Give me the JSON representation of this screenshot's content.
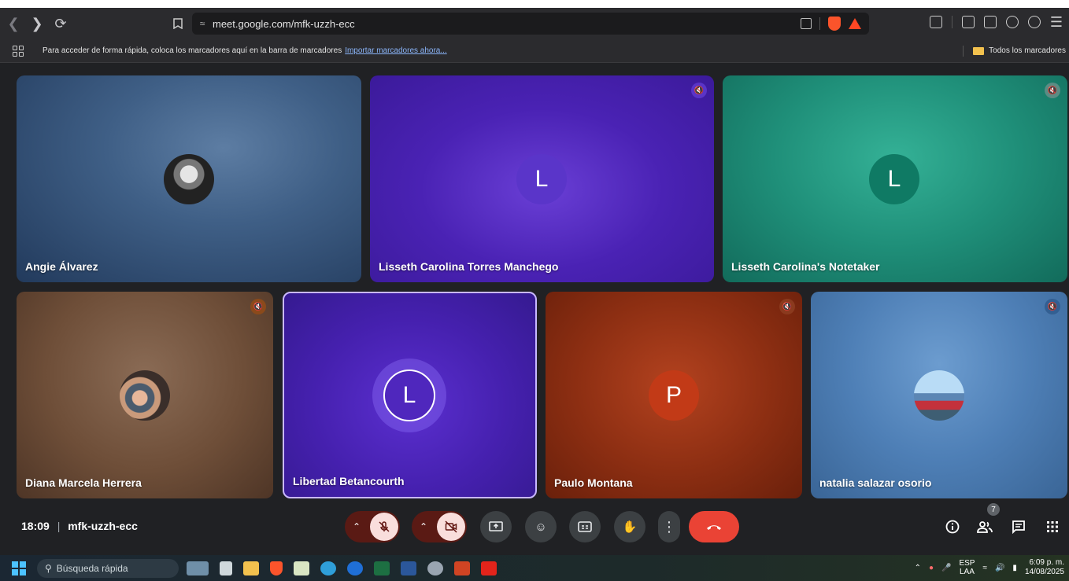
{
  "browser": {
    "url": "meet.google.com/mfk-uzzh-ecc",
    "bookmark_hint": "Para acceder de forma rápida, coloca los marcadores aquí en la barra de marcadores",
    "bookmark_import": "Importar marcadores ahora...",
    "all_bookmarks": "Todos los marcadores"
  },
  "participants": [
    {
      "name": "Angie Álvarez",
      "avatar": "photo",
      "muted": false
    },
    {
      "name": "Lisseth Carolina Torres Manchego",
      "avatar_letter": "L",
      "muted": true
    },
    {
      "name": "Lisseth Carolina's Notetaker",
      "avatar_letter": "L",
      "muted": true
    },
    {
      "name": "Diana Marcela Herrera",
      "avatar": "photo",
      "muted": true
    },
    {
      "name": "Libertad Betancourth",
      "avatar_letter": "L",
      "muted": false,
      "speaking": true
    },
    {
      "name": "Paulo Montana",
      "avatar_letter": "P",
      "muted": true
    },
    {
      "name": "natalia salazar osorio",
      "avatar": "photo",
      "muted": true
    }
  ],
  "meeting": {
    "time": "18:09",
    "code": "mfk-uzzh-ecc",
    "participant_count": "7"
  },
  "taskbar": {
    "search_placeholder": "Búsqueda rápida",
    "lang_top": "ESP",
    "lang_bottom": "LAA",
    "time": "6:09 p. m.",
    "date": "14/08/2025"
  },
  "colors": {
    "hangup": "#ea4335",
    "muted_control_bg": "#f9dedc",
    "speaking_border": "#c9b8ff"
  }
}
